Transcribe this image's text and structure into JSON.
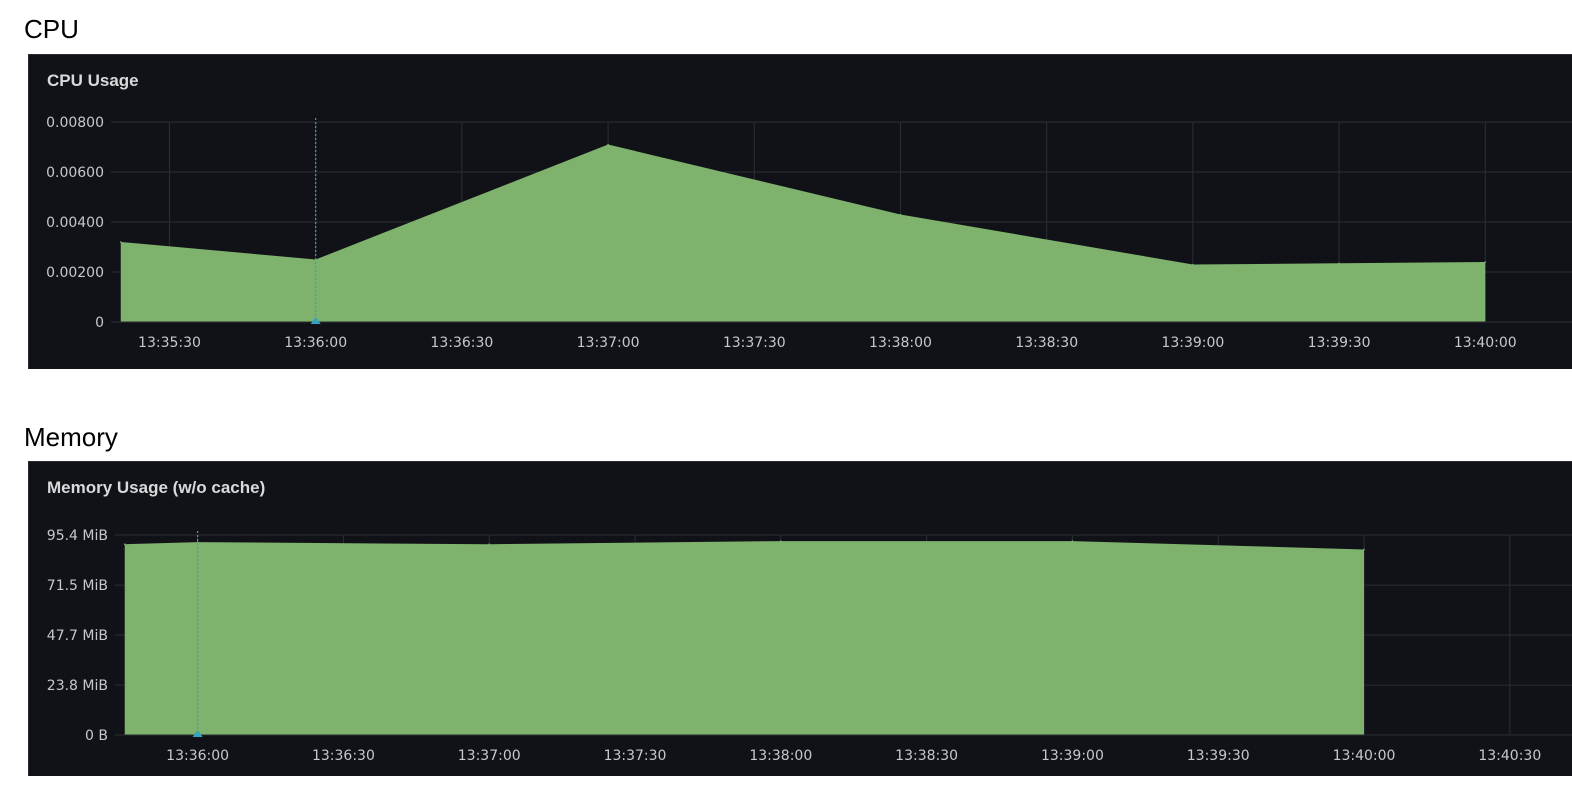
{
  "sections": {
    "cpu": {
      "heading": "CPU"
    },
    "memory": {
      "heading": "Memory"
    }
  },
  "colors": {
    "series_fill": "#7eb26d",
    "panel_bg": "#111217",
    "grid": "#2c2e35",
    "cursor": "#36a2c2",
    "tick_text": "#c7c8ca"
  },
  "chart_data": [
    {
      "type": "area",
      "title": "CPU Usage",
      "xlabel": "",
      "ylabel": "",
      "x": [
        "13:35:20",
        "13:36:00",
        "13:37:00",
        "13:38:00",
        "13:39:00",
        "13:39:30",
        "13:40:00"
      ],
      "series": [
        {
          "values": [
            0.0032,
            0.0025,
            0.0071,
            0.0043,
            0.0023,
            0.00235,
            0.0024
          ]
        }
      ],
      "yticks": [
        "0",
        "0.00200",
        "0.00400",
        "0.00600",
        "0.00800"
      ],
      "ytick_values": [
        0,
        0.002,
        0.004,
        0.006,
        0.008
      ],
      "xticks": [
        "13:35:30",
        "13:36:00",
        "13:36:30",
        "13:37:00",
        "13:37:30",
        "13:38:00",
        "13:38:30",
        "13:39:00",
        "13:39:30",
        "13:40:00"
      ],
      "xlim": [
        "13:35:18",
        "13:40:18"
      ],
      "ylim": [
        0,
        0.008
      ],
      "cursor_x": "13:36:00",
      "grid": true,
      "legend": "none"
    },
    {
      "type": "area",
      "title": "Memory Usage (w/o cache)",
      "xlabel": "",
      "ylabel": "",
      "x": [
        "13:35:45",
        "13:36:00",
        "13:37:00",
        "13:38:00",
        "13:39:00",
        "13:40:00"
      ],
      "series": [
        {
          "values": [
            91.0,
            92.0,
            91.0,
            92.5,
            92.5,
            88.5
          ]
        }
      ],
      "yticks": [
        "0 B",
        "23.8 MiB",
        "47.7 MiB",
        "71.5 MiB",
        "95.4 MiB"
      ],
      "ytick_values": [
        0,
        23.8,
        47.7,
        71.5,
        95.4
      ],
      "xticks": [
        "13:36:00",
        "13:36:30",
        "13:37:00",
        "13:37:30",
        "13:38:00",
        "13:38:30",
        "13:39:00",
        "13:39:30",
        "13:40:00",
        "13:40:30"
      ],
      "xlim": [
        "13:35:43",
        "13:40:43"
      ],
      "ylim": [
        0,
        95.4
      ],
      "cursor_x": "13:36:00",
      "grid": true,
      "legend": "none"
    }
  ]
}
